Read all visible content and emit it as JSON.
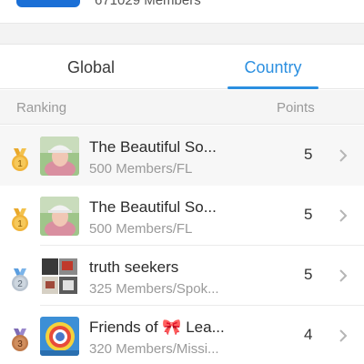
{
  "header": {
    "members_text": "671029 Members"
  },
  "tabs": [
    {
      "label": "Global",
      "active": false
    },
    {
      "label": "Country",
      "active": true
    }
  ],
  "columns": {
    "ranking": "Ranking",
    "points": "Points"
  },
  "rows": [
    {
      "rank": "1",
      "name": "The Beautiful So...",
      "meta": "500 Members/FL",
      "points": "5",
      "medal": "gold"
    },
    {
      "rank": "1",
      "name": "The Beautiful So...",
      "meta": "500 Members/FL",
      "points": "5",
      "medal": "gold"
    },
    {
      "rank": "2",
      "name": "truth seekers",
      "meta": "325 Members/Spok...",
      "points": "5",
      "medal": "silver"
    },
    {
      "rank": "3",
      "name": "Friends of 🎀 Lea...",
      "meta": "320 Members/Missi...",
      "points": "4",
      "medal": "bronze"
    }
  ],
  "colors": {
    "accent": "#2b8fe0",
    "gold": "#f0b43a",
    "silver": "#b8c3cf",
    "bronze": "#c07a4a"
  }
}
